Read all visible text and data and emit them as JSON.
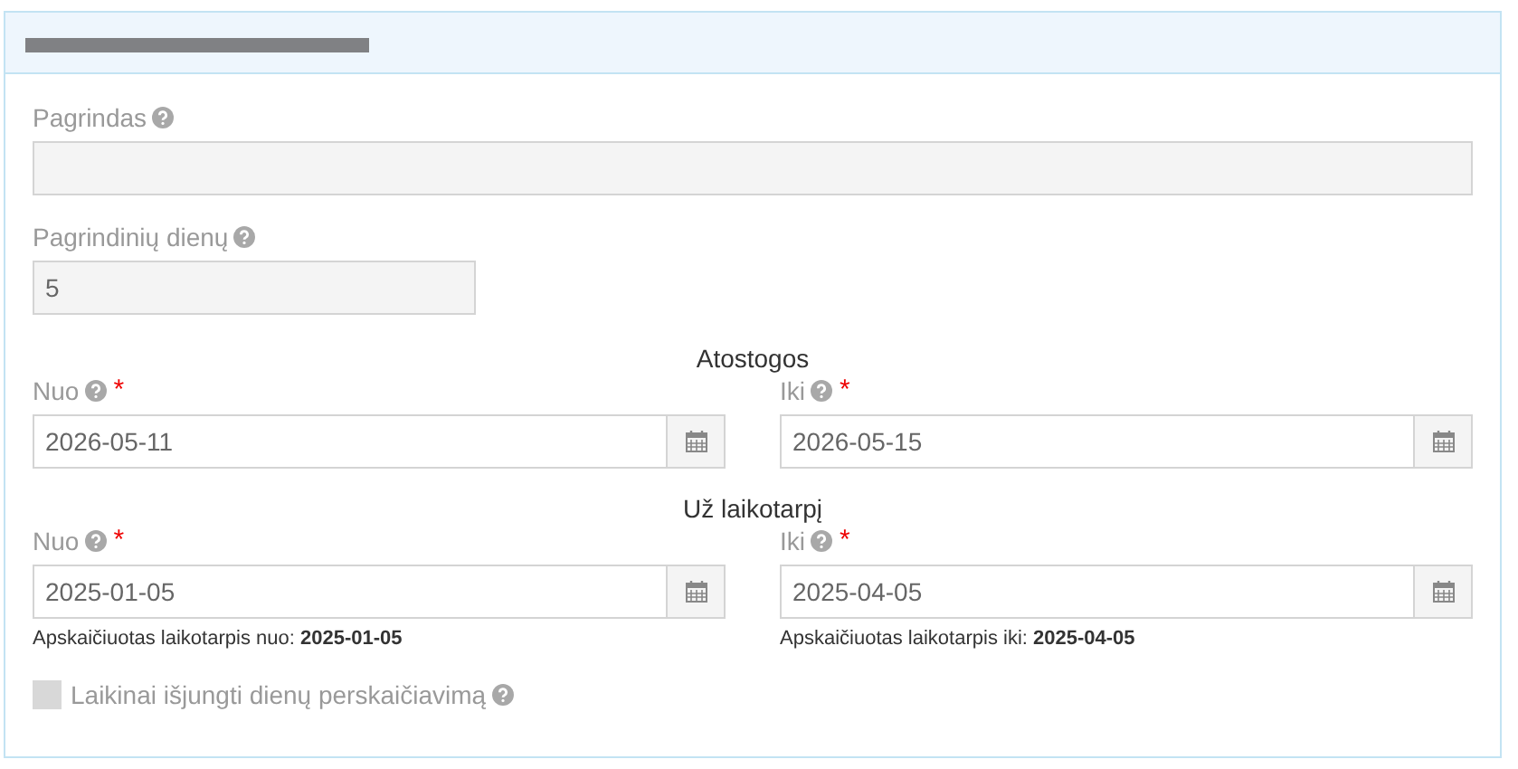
{
  "basis": {
    "label": "Pagrindas"
  },
  "main_days": {
    "label": "Pagrindinių dienų",
    "value": "5"
  },
  "sections": [
    {
      "title": "Atostogos",
      "fields": [
        {
          "label": "Nuo",
          "required_mark": "*",
          "value": "2026-05-11"
        },
        {
          "label": "Iki",
          "required_mark": "*",
          "value": "2026-05-15"
        }
      ]
    },
    {
      "title": "Už laikotarpį",
      "fields": [
        {
          "label": "Nuo",
          "required_mark": "*",
          "value": "2025-01-05",
          "note": "Apskaičiuotas laikotarpis nuo: **2025-01-05**"
        },
        {
          "label": "Iki",
          "required_mark": "*",
          "value": "2025-04-05",
          "note": "Apskaičiuotas laikotarpis iki: **2025-04-05**"
        }
      ]
    }
  ],
  "checkbox": {
    "label": "Laikinai išjungti dienų perskaičiavimą",
    "checked": false,
    "disabled": true
  }
}
